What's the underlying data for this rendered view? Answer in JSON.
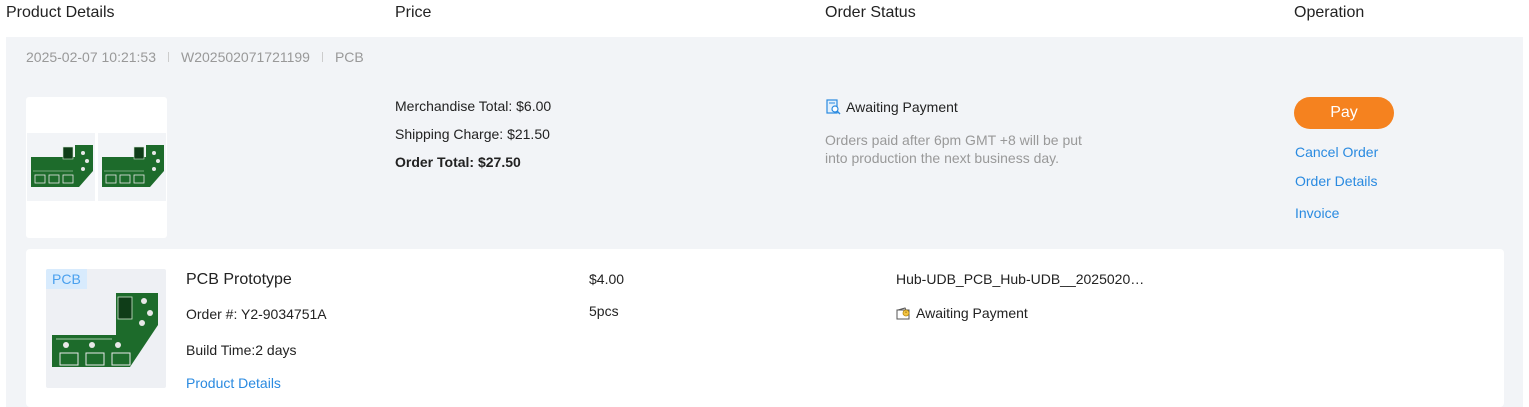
{
  "header": {
    "product_details": "Product Details",
    "price": "Price",
    "order_status": "Order Status",
    "operation": "Operation"
  },
  "order": {
    "date": "2025-02-07 10:21:53",
    "order_no": "W202502071721199",
    "category": "PCB",
    "price": {
      "merchandise_total": "Merchandise Total: $6.00",
      "shipping_charge": "Shipping Charge: $21.50",
      "order_total": "Order Total: $27.50"
    },
    "status": {
      "label": "Awaiting Payment",
      "note": "Orders paid after 6pm GMT +8 will be put into production the next business day."
    },
    "operations": {
      "pay": "Pay",
      "cancel": "Cancel Order",
      "details": "Order Details",
      "invoice": "Invoice"
    }
  },
  "item": {
    "tag": "PCB",
    "title": "PCB Prototype",
    "order_number": "Order #: Y2-9034751A",
    "build_time": "Build Time:2 days",
    "details_link": "Product Details",
    "unit_price": "$4.00",
    "quantity": "5pcs",
    "file_name": "Hub-UDB_PCB_Hub-UDB__2025020…",
    "status": "Awaiting Payment"
  },
  "colors": {
    "accent_orange": "#f5821f",
    "link_blue": "#2a8ae0",
    "pcb_green": "#1d6b2b",
    "background_gray": "#f2f4f7"
  }
}
